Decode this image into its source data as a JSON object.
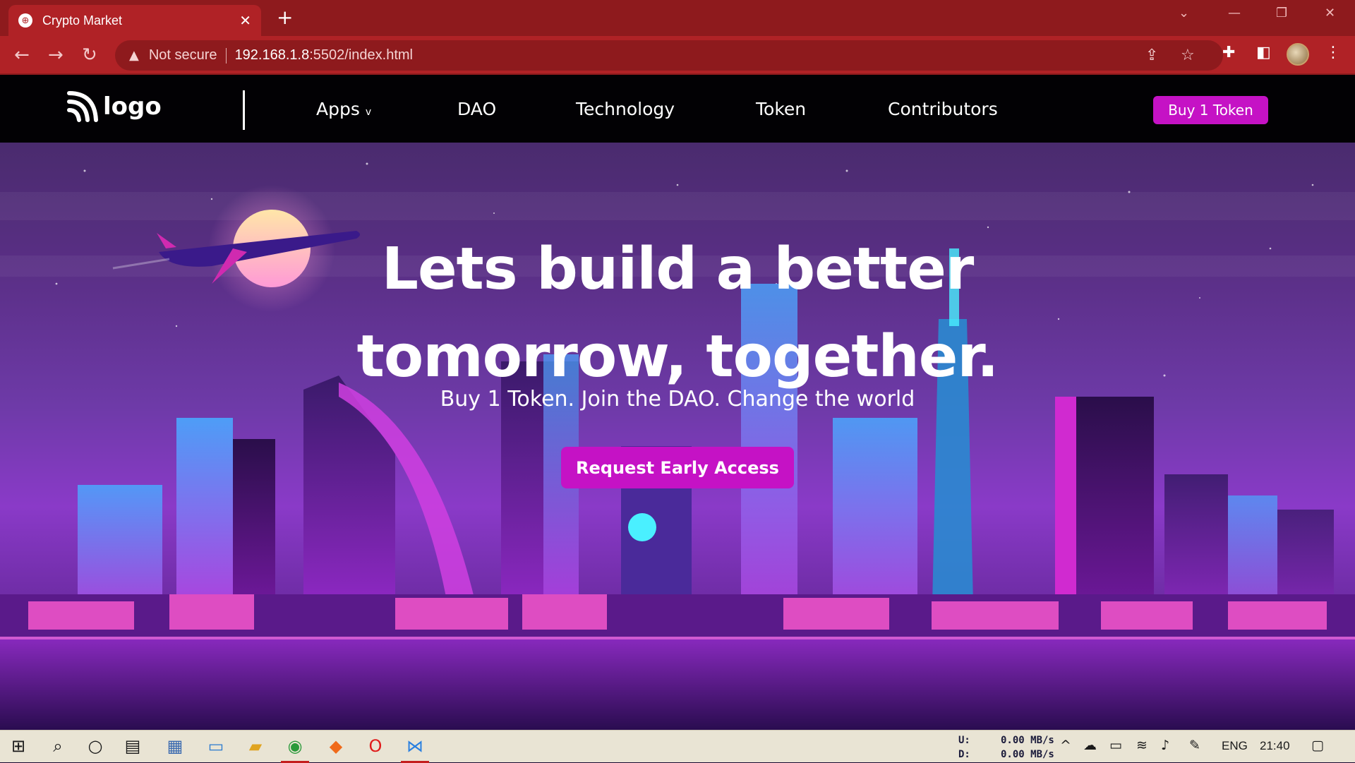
{
  "browser": {
    "tab_title": "Crypto Market",
    "security_label": "Not secure",
    "url_host": "192.168.1.8",
    "url_path": ":5502/index.html"
  },
  "site": {
    "logo_text": "logo",
    "nav": [
      {
        "label": "Apps",
        "dropdown": "v"
      },
      {
        "label": "DAO"
      },
      {
        "label": "Technology"
      },
      {
        "label": "Token"
      },
      {
        "label": "Contributors"
      }
    ],
    "buy_button": "Buy 1 Token",
    "hero": {
      "title_line1": "Lets build a better",
      "title_line2": "tomorrow, together.",
      "subtitle": "Buy 1 Token. Join the DAO. Change the world",
      "cta": "Request Early Access"
    },
    "colors": {
      "accent": "#c512c5",
      "navbar": "#020104",
      "browser_frame": "#b02226"
    }
  },
  "taskbar": {
    "net_up_label": "U:",
    "net_down_label": "D:",
    "net_up": "0.00 MB/s",
    "net_down": "0.00 MB/s",
    "language": "ENG",
    "time": "21:40"
  }
}
